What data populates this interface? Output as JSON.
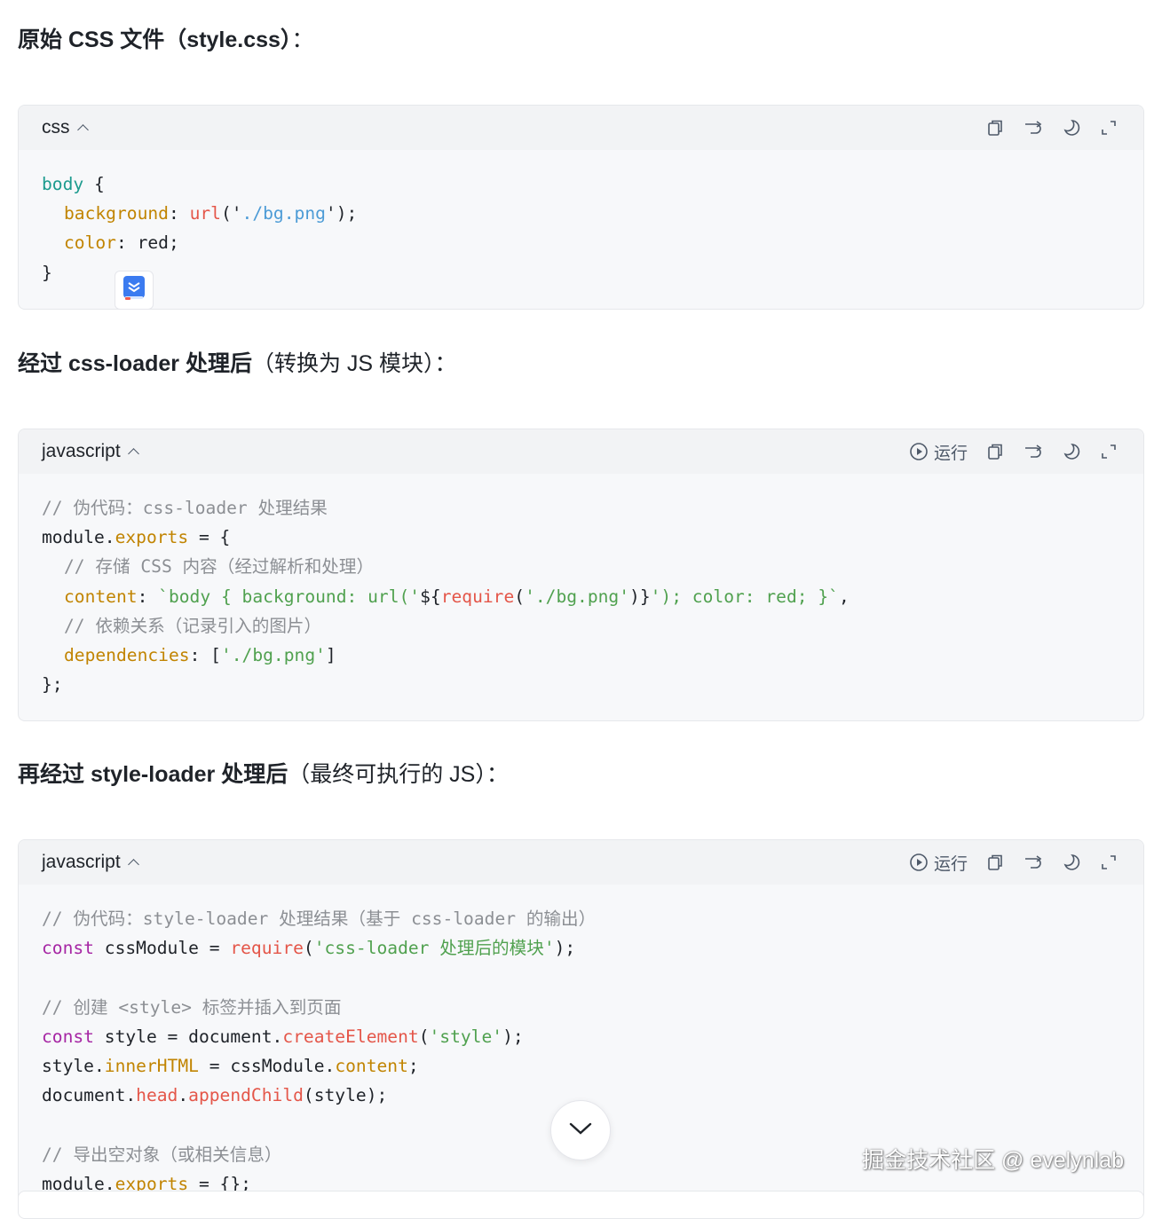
{
  "sections": [
    {
      "heading_bold": "原始 CSS 文件（style.css）",
      "heading_rest": "：",
      "block": {
        "lang": "css",
        "run_label": "",
        "lines": [
          [
            {
              "t": "body",
              "c": "sel"
            },
            {
              "t": " {",
              "c": "pl"
            }
          ],
          [
            {
              "t": "background",
              "c": "prop"
            },
            {
              "t": ": ",
              "c": "pl"
            },
            {
              "t": "url",
              "c": "fn"
            },
            {
              "t": "('",
              "c": "pl"
            },
            {
              "t": "./bg.png",
              "c": "strb"
            },
            {
              "t": "');",
              "c": "pl"
            }
          ],
          [
            {
              "t": "color",
              "c": "prop"
            },
            {
              "t": ": red;",
              "c": "pl"
            }
          ],
          [
            {
              "t": "}",
              "c": "pl"
            }
          ]
        ],
        "indents": [
          0,
          1,
          1,
          0
        ]
      }
    },
    {
      "heading_bold": "经过 css-loader 处理后",
      "heading_rest": "（转换为 JS 模块）：",
      "block": {
        "lang": "javascript",
        "run_label": "运行",
        "lines": [
          [
            {
              "t": "// 伪代码：css-loader 处理结果",
              "c": "cm"
            }
          ],
          [
            {
              "t": "module.",
              "c": "pl"
            },
            {
              "t": "exports",
              "c": "prop"
            },
            {
              "t": " = {",
              "c": "pl"
            }
          ],
          [
            {
              "t": "// 存储 CSS 内容（经过解析和处理）",
              "c": "cm"
            }
          ],
          [
            {
              "t": "content",
              "c": "prop"
            },
            {
              "t": ": ",
              "c": "pl"
            },
            {
              "t": "`body { background: url('",
              "c": "str"
            },
            {
              "t": "${",
              "c": "pl"
            },
            {
              "t": "require",
              "c": "fn"
            },
            {
              "t": "(",
              "c": "pl"
            },
            {
              "t": "'./bg.png'",
              "c": "str"
            },
            {
              "t": ")}",
              "c": "pl"
            },
            {
              "t": "'); color: red; }`",
              "c": "str"
            },
            {
              "t": ",",
              "c": "pl"
            }
          ],
          [
            {
              "t": "// 依赖关系（记录引入的图片）",
              "c": "cm"
            }
          ],
          [
            {
              "t": "dependencies",
              "c": "prop"
            },
            {
              "t": ": [",
              "c": "pl"
            },
            {
              "t": "'./bg.png'",
              "c": "str"
            },
            {
              "t": "]",
              "c": "pl"
            }
          ],
          [
            {
              "t": "};",
              "c": "pl"
            }
          ]
        ],
        "indents": [
          0,
          0,
          1,
          1,
          1,
          1,
          0
        ]
      }
    },
    {
      "heading_bold": "再经过 style-loader 处理后",
      "heading_rest": "（最终可执行的 JS）：",
      "block": {
        "lang": "javascript",
        "run_label": "运行",
        "lines": [
          [
            {
              "t": "// 伪代码：style-loader 处理结果（基于 css-loader 的输出）",
              "c": "cm"
            }
          ],
          [
            {
              "t": "const",
              "c": "kw"
            },
            {
              "t": " cssModule = ",
              "c": "pl"
            },
            {
              "t": "require",
              "c": "fn"
            },
            {
              "t": "(",
              "c": "pl"
            },
            {
              "t": "'css-loader 处理后的模块'",
              "c": "str"
            },
            {
              "t": ");",
              "c": "pl"
            }
          ],
          [],
          [
            {
              "t": "// 创建 <style> 标签并插入到页面",
              "c": "cm"
            }
          ],
          [
            {
              "t": "const",
              "c": "kw"
            },
            {
              "t": " style = document.",
              "c": "pl"
            },
            {
              "t": "createElement",
              "c": "fn"
            },
            {
              "t": "(",
              "c": "pl"
            },
            {
              "t": "'style'",
              "c": "str"
            },
            {
              "t": ");",
              "c": "pl"
            }
          ],
          [
            {
              "t": "style.",
              "c": "pl"
            },
            {
              "t": "innerHTML",
              "c": "prop"
            },
            {
              "t": " = cssModule.",
              "c": "pl"
            },
            {
              "t": "content",
              "c": "prop"
            },
            {
              "t": ";",
              "c": "pl"
            }
          ],
          [
            {
              "t": "document.",
              "c": "pl"
            },
            {
              "t": "head",
              "c": "fn"
            },
            {
              "t": ".",
              "c": "pl"
            },
            {
              "t": "appendChild",
              "c": "fn"
            },
            {
              "t": "(style);",
              "c": "pl"
            }
          ],
          [],
          [
            {
              "t": "// 导出空对象（或相关信息）",
              "c": "cm"
            }
          ],
          [
            {
              "t": "module.",
              "c": "pl"
            },
            {
              "t": "exports",
              "c": "prop"
            },
            {
              "t": " = {};",
              "c": "pl"
            }
          ]
        ],
        "indents": [
          0,
          0,
          0,
          0,
          0,
          0,
          0,
          0,
          0,
          0
        ]
      }
    }
  ],
  "watermark": "掘金技术社区 @ evelynlab",
  "icons": {
    "copy": "copy-icon",
    "wrap": "wrap-icon",
    "theme": "theme-moon-icon",
    "expand": "expand-icon",
    "run": "play-icon",
    "scroll": "chevron-down-icon",
    "floating": "bookmark-app-icon"
  },
  "colors": {
    "selector": "#1c9b8e",
    "property": "#c18401",
    "function": "#e45649",
    "string": "#50a14f",
    "string_blue": "#4c9bd6",
    "keyword": "#a626a4",
    "comment": "#8c8f94"
  }
}
